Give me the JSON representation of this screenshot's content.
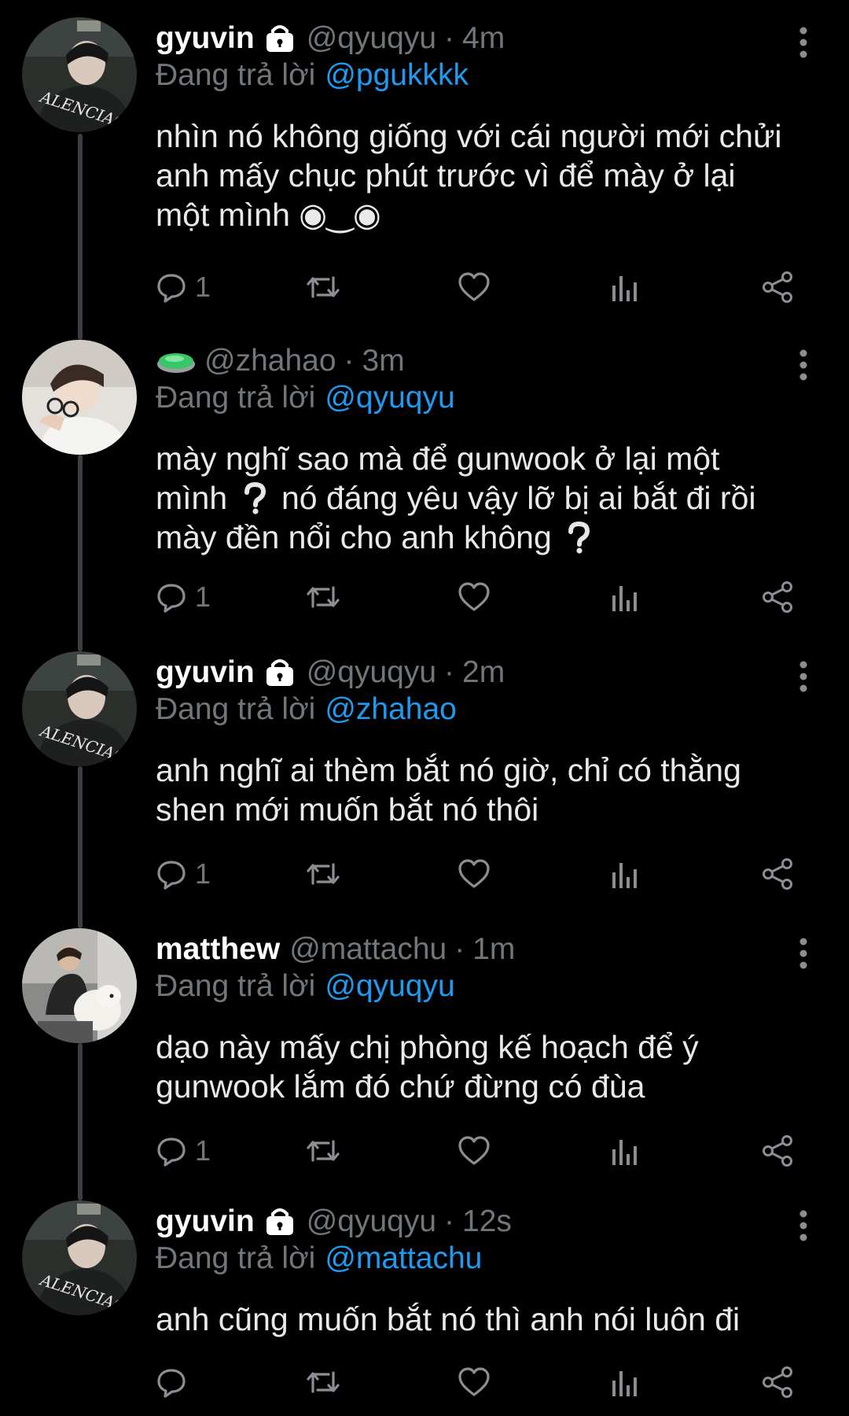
{
  "colors": {
    "background": "#000000",
    "text": "#e7e9ea",
    "muted": "#71767b",
    "link": "#1d9bf0",
    "thread_line": "#3a3d41"
  },
  "tweets": [
    {
      "display_name": "gyuvin",
      "handle": "@qyuqyu",
      "separator": "·",
      "time": "4m",
      "reply_prefix": "Đang trả lời",
      "reply_to": "@pgukkkk",
      "text_lines": [
        "nhìn nó không giống với cái người mới chửi",
        "anh mấy chục phút trước vì để mày ở lại",
        "một mình ◉‿◉"
      ],
      "reply_count": "1"
    },
    {
      "display_name": "",
      "handle": "@zhahao",
      "separator": "·",
      "time": "3m",
      "reply_prefix": "Đang trả lời",
      "reply_to": "@qyuqyu",
      "text_lines": [
        "mày nghĩ sao mà để gunwook ở lại một",
        "mình",
        "nó đáng yêu vậy lỡ bị ai bắt đi rồi",
        "mày đền nổi cho anh không"
      ],
      "reply_count": "1"
    },
    {
      "display_name": "gyuvin",
      "handle": "@qyuqyu",
      "separator": "·",
      "time": "2m",
      "reply_prefix": "Đang trả lời",
      "reply_to": "@zhahao",
      "text_lines": [
        "anh nghĩ ai thèm bắt nó giờ, chỉ có thằng",
        "shen mới muốn bắt nó thôi"
      ],
      "reply_count": "1"
    },
    {
      "display_name": "matthew",
      "handle": "@mattachu",
      "separator": "·",
      "time": "1m",
      "reply_prefix": "Đang trả lời",
      "reply_to": "@qyuqyu",
      "text_lines": [
        "dạo này mấy chị phòng kế hoạch để ý",
        "gunwook lắm đó chứ đừng có đùa"
      ],
      "reply_count": "1"
    },
    {
      "display_name": "gyuvin",
      "handle": "@qyuqyu",
      "separator": "·",
      "time": "12s",
      "reply_prefix": "Đang trả lời",
      "reply_to": "@mattachu",
      "text_lines": [
        "anh cũng muốn bắt nó thì anh nói luôn đi"
      ],
      "reply_count": ""
    }
  ]
}
